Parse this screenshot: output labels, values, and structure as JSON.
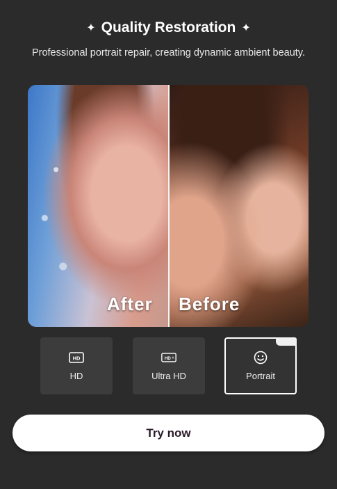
{
  "header": {
    "title": "Quality Restoration",
    "subtitle": "Professional portrait repair, creating dynamic ambient beauty."
  },
  "comparison": {
    "after_label": "After",
    "before_label": "Before"
  },
  "modes": [
    {
      "label": "HD",
      "icon": "hd-icon",
      "selected": false
    },
    {
      "label": "Ultra HD",
      "icon": "hd-plus-icon",
      "selected": false
    },
    {
      "label": "Portrait",
      "icon": "smiley-face-icon",
      "selected": true
    }
  ],
  "cta": {
    "label": "Try now"
  },
  "colors": {
    "background": "#2b2b2b",
    "card": "#3c3c3c",
    "button": "#ffffff",
    "button_text": "#2a1a28"
  }
}
